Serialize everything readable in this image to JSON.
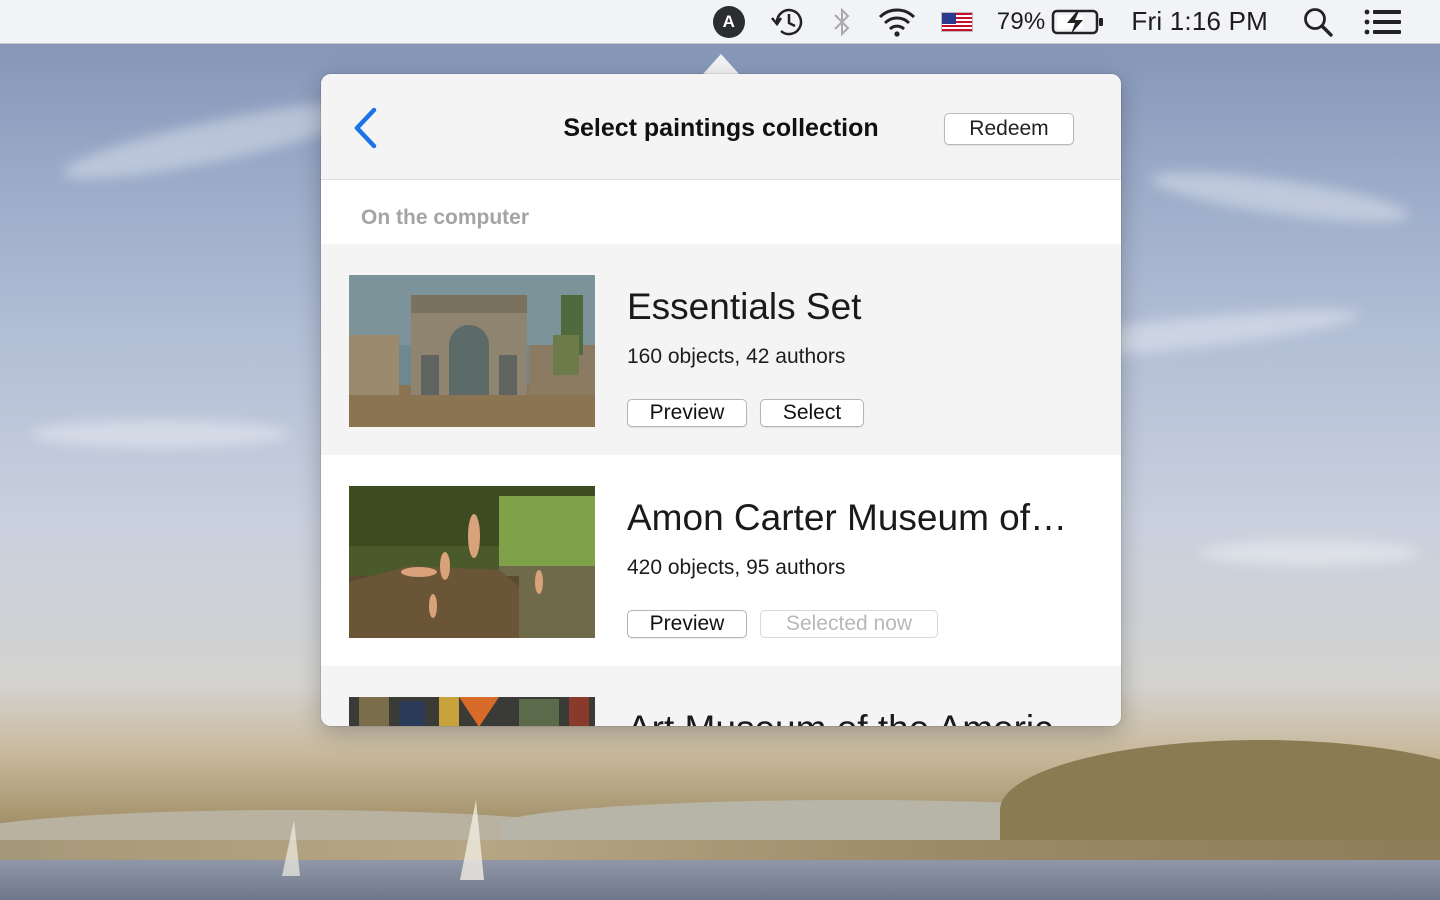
{
  "menubar": {
    "user_initial": "A",
    "battery_percent": "79%",
    "clock": "Fri 1:16 PM",
    "icons": [
      "user-avatar-icon",
      "time-machine-icon",
      "bluetooth-icon",
      "wifi-icon",
      "us-flag-icon",
      "battery-charging-icon",
      "spotlight-search-icon",
      "notification-center-icon"
    ]
  },
  "popover": {
    "title": "Select paintings collection",
    "redeem_label": "Redeem",
    "section_label": "On the computer",
    "collections": [
      {
        "title": "Essentials Set",
        "meta": "160 objects, 42 authors",
        "preview_label": "Preview",
        "action_label": "Select",
        "action_enabled": true
      },
      {
        "title": "Amon Carter Museum of…",
        "meta": "420 objects, 95 authors",
        "preview_label": "Preview",
        "action_label": "Selected now",
        "action_enabled": false
      },
      {
        "title": "Art Museum of the Americ"
      }
    ]
  },
  "colors": {
    "accent_blue": "#1a73e8",
    "menubar_bg": "#f6f6f8",
    "popover_bg": "#f4f4f4",
    "section_label": "#a4a4a4",
    "disabled_text": "#b8b8b8"
  }
}
